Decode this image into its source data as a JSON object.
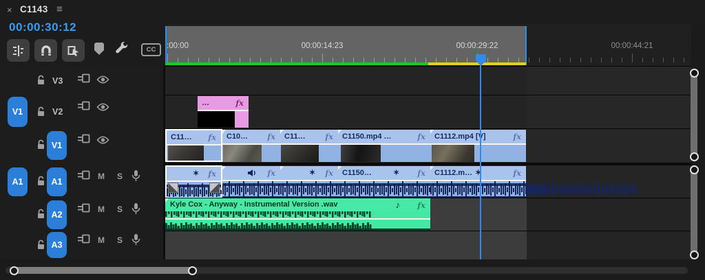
{
  "tab": {
    "close": "×",
    "title": "C1143",
    "menu": "≡"
  },
  "timecode": "00:00:30:12",
  "toolbar": {
    "cc": "CC"
  },
  "ruler": {
    "labels": [
      ":00:00",
      "00:00:14:23",
      "00:00:29:22",
      "00:00:44:21"
    ]
  },
  "labels": {
    "fx": "fx",
    "star": "✶",
    "note": "♪",
    "mute": "M",
    "solo": "S"
  },
  "tracks": {
    "video": [
      {
        "name": "V3",
        "source": ""
      },
      {
        "name": "V2",
        "source": "V1"
      },
      {
        "name": "V1",
        "source": ""
      }
    ],
    "audio": [
      {
        "name": "A1",
        "source": "A1"
      },
      {
        "name": "A2",
        "source": ""
      },
      {
        "name": "A3",
        "source": ""
      }
    ]
  },
  "clips": {
    "v2": [
      {
        "label": "…"
      }
    ],
    "v1": [
      {
        "label": "C11…"
      },
      {
        "label": "C10…"
      },
      {
        "label": "C11…"
      },
      {
        "label": "C1150.mp4 …"
      },
      {
        "label": "C1112.mp4 [V]"
      }
    ],
    "a1": [
      {
        "label": ""
      },
      {
        "label": ""
      },
      {
        "label": ""
      },
      {
        "label": "C1150…"
      },
      {
        "label": "C1112.m…"
      }
    ],
    "a2": [
      {
        "label": "Kyle Cox - Anyway - Instrumental Version .wav"
      }
    ]
  },
  "colors": {
    "accent": "#2e8deb",
    "timecode_blue": "#3d9bea",
    "clip_video": "#90b3e3",
    "clip_graphic": "#e89ae2",
    "clip_music": "#43e8a5",
    "render_green": "#16cd19",
    "render_yellow": "#e4d01b"
  }
}
